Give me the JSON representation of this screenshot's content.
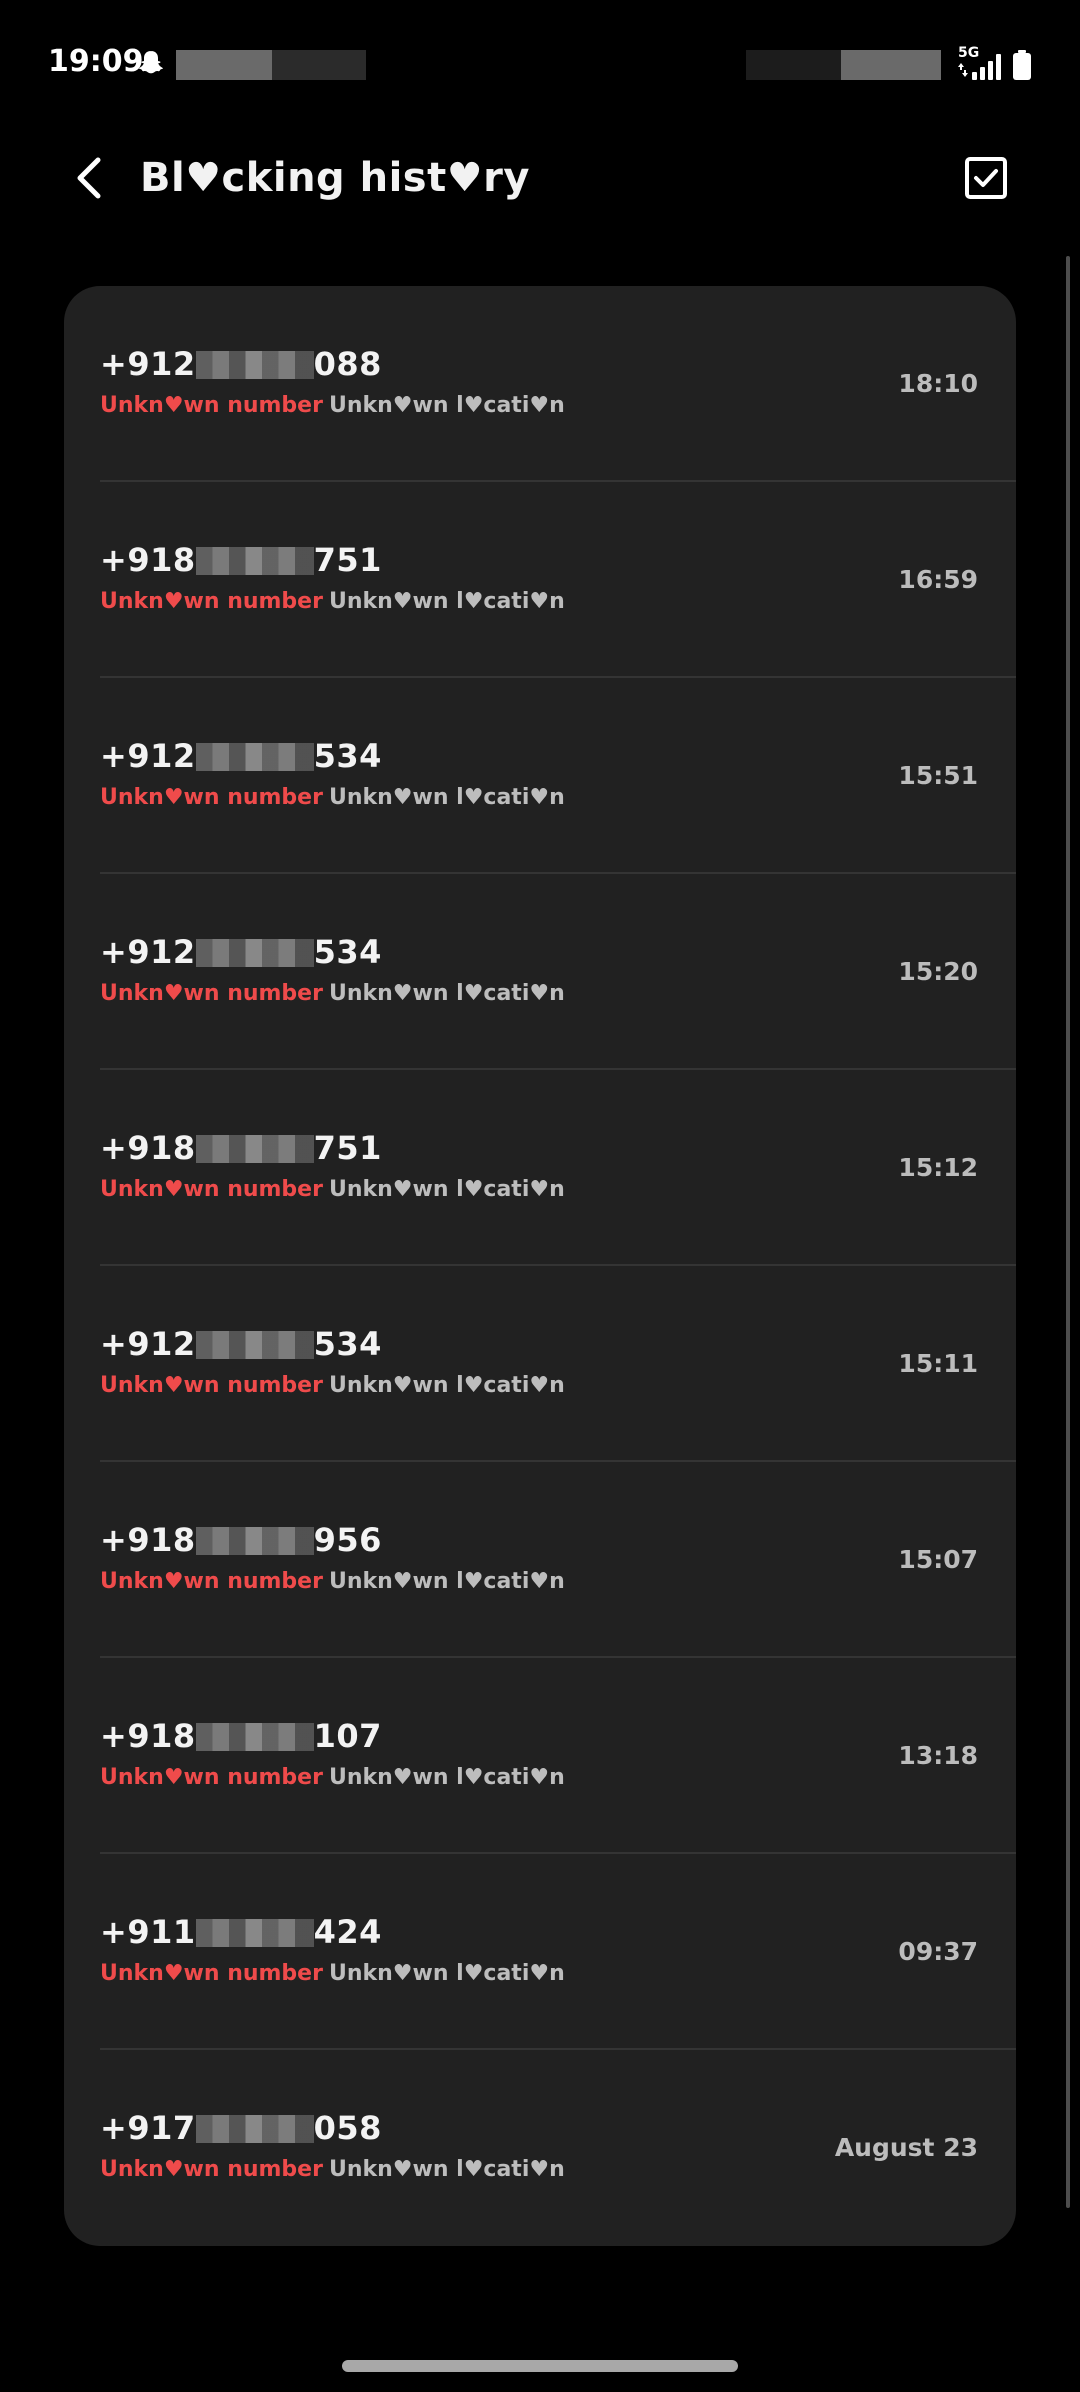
{
  "status_bar": {
    "time": "19:09",
    "network": "5G",
    "icons": [
      "snapchat-icon",
      "signal-icon",
      "battery-icon"
    ]
  },
  "header": {
    "title": "Bl♥cking hist♥ry",
    "back_icon": "chevron-left-icon",
    "action_icon": "checkbox-icon"
  },
  "list": {
    "items": [
      {
        "prefix": "+912",
        "suffix": "088",
        "label": "Unkn♥wn number",
        "location": "Unkn♥wn l♥cati♥n",
        "time": "18:10"
      },
      {
        "prefix": "+918",
        "suffix": "751",
        "label": "Unkn♥wn number",
        "location": "Unkn♥wn l♥cati♥n",
        "time": "16:59"
      },
      {
        "prefix": "+912",
        "suffix": "534",
        "label": "Unkn♥wn number",
        "location": "Unkn♥wn l♥cati♥n",
        "time": "15:51"
      },
      {
        "prefix": "+912",
        "suffix": "534",
        "label": "Unkn♥wn number",
        "location": "Unkn♥wn l♥cati♥n",
        "time": "15:20"
      },
      {
        "prefix": "+918",
        "suffix": "751",
        "label": "Unkn♥wn number",
        "location": "Unkn♥wn l♥cati♥n",
        "time": "15:12"
      },
      {
        "prefix": "+912",
        "suffix": "534",
        "label": "Unkn♥wn number",
        "location": "Unkn♥wn l♥cati♥n",
        "time": "15:11"
      },
      {
        "prefix": "+918",
        "suffix": "956",
        "label": "Unkn♥wn number",
        "location": "Unkn♥wn l♥cati♥n",
        "time": "15:07"
      },
      {
        "prefix": "+918",
        "suffix": "107",
        "label": "Unkn♥wn number",
        "location": "Unkn♥wn l♥cati♥n",
        "time": "13:18"
      },
      {
        "prefix": "+911",
        "suffix": "424",
        "label": "Unkn♥wn number",
        "location": "Unkn♥wn l♥cati♥n",
        "time": "09:37"
      },
      {
        "prefix": "+917",
        "suffix": "058",
        "label": "Unkn♥wn number",
        "location": "Unkn♥wn l♥cati♥n",
        "time": "August 23"
      }
    ]
  },
  "colors": {
    "background": "#000000",
    "card": "#212121",
    "accent_red": "#ef4b4b",
    "secondary_text": "#bdbdbd"
  }
}
